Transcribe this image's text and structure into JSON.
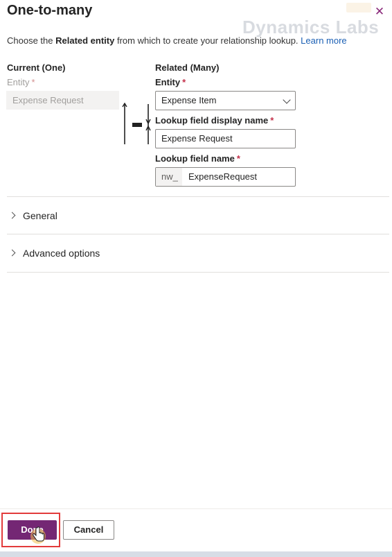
{
  "dialog": {
    "title": "One-to-many",
    "close_icon": "close-icon",
    "watermark": "Dynamics Labs",
    "intro_prefix": "Choose the ",
    "intro_bold": "Related entity",
    "intro_suffix": " from which to create your relationship lookup.",
    "learn_more": "Learn more"
  },
  "current": {
    "heading": "Current (One)",
    "entity_label": "Entity",
    "required_mark": "*",
    "entity_value": "Expense Request"
  },
  "related": {
    "heading": "Related (Many)",
    "entity_label": "Entity",
    "entity_value": "Expense Item",
    "display_name_label": "Lookup field display name",
    "display_name_value": "Expense Request",
    "field_name_label": "Lookup field name",
    "field_name_prefix": "nw_",
    "field_name_value": "ExpenseRequest",
    "required_mark": "*"
  },
  "sections": [
    {
      "label": "General"
    },
    {
      "label": "Advanced options"
    }
  ],
  "footer": {
    "done_label": "Done",
    "cancel_label": "Cancel"
  },
  "colors": {
    "primary": "#742774",
    "required": "#c4314b",
    "link": "#1a5fb4",
    "highlight": "#e23b3b"
  },
  "icons": {
    "relationship": "one-to-many-relationship-icon",
    "dropdown": "chevron-down-icon",
    "section": "chevron-right-icon",
    "cursor": "hand-pointer-icon"
  }
}
